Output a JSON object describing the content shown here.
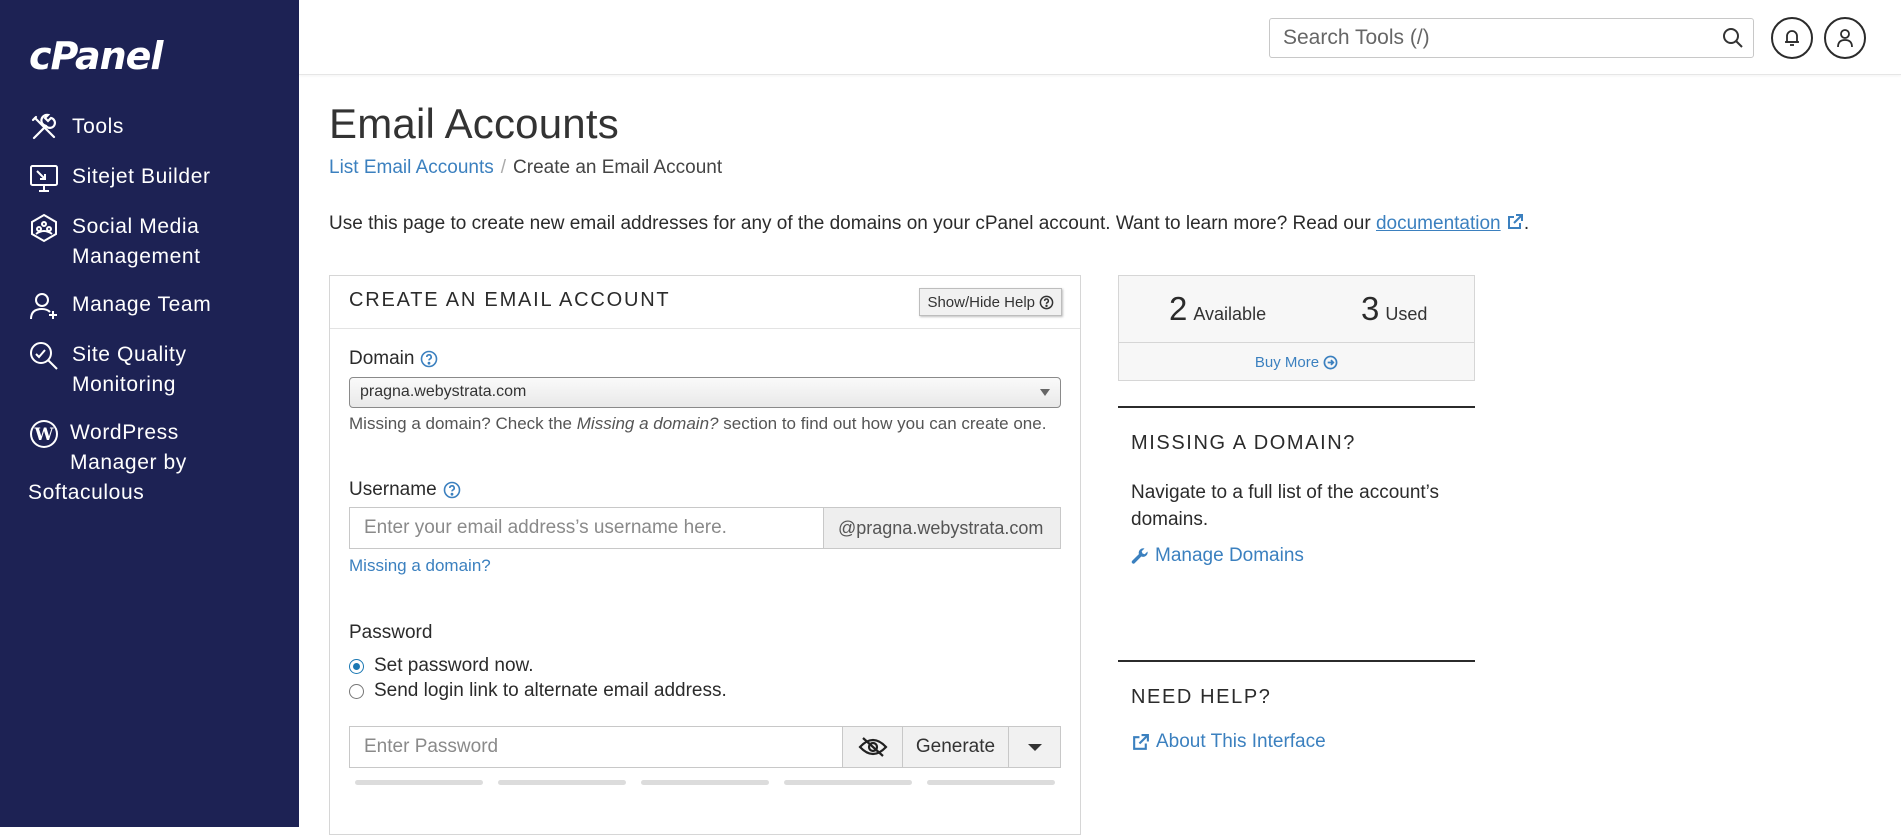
{
  "app": {
    "logo": "cPanel"
  },
  "sidebar": {
    "items": [
      {
        "label": "Tools",
        "icon": "tools-icon"
      },
      {
        "label": "Sitejet Builder",
        "icon": "sitejet-monitor-icon"
      },
      {
        "label": "Social Media",
        "label2": "Management",
        "icon": "social-media-icon"
      },
      {
        "label": "Manage Team",
        "icon": "manage-team-icon"
      },
      {
        "label": "Site Quality",
        "label2": "Monitoring",
        "icon": "site-quality-icon"
      },
      {
        "label": "WordPress",
        "label2": "Manager by",
        "label3": "Softaculous",
        "icon": "wordpress-icon"
      }
    ]
  },
  "topbar": {
    "search_placeholder": "Search Tools (/)",
    "icons": [
      "search-icon",
      "bell-icon",
      "user-icon"
    ]
  },
  "page": {
    "title": "Email Accounts",
    "breadcrumb": {
      "parent": "List Email Accounts",
      "separator": "/",
      "current": "Create an Email Account"
    },
    "intro_text": "Use this page to create new email addresses for any of the domains on your cPanel account. Want to learn more? Read our",
    "intro_link": "documentation",
    "intro_end": "."
  },
  "form": {
    "title": "CREATE AN EMAIL ACCOUNT",
    "help_button": "Show/Hide Help",
    "domain": {
      "label": "Domain",
      "value": "pragna.webystrata.com",
      "hint_pre": "Missing a domain? Check the",
      "hint_em": "Missing a domain?",
      "hint_post": "section to find out how you can create one."
    },
    "username": {
      "label": "Username",
      "placeholder": "Enter your email address’s username here.",
      "suffix": "@pragna.webystrata.com",
      "missing_link": "Missing a domain?"
    },
    "password": {
      "label": "Password",
      "option_set_now": "Set password now.",
      "option_send_link": "Send login link to alternate email address.",
      "placeholder": "Enter Password",
      "generate_label": "Generate"
    }
  },
  "stats": {
    "available_count": "2",
    "available_label": "Available",
    "used_count": "3",
    "used_label": "Used",
    "buy_more": "Buy More"
  },
  "missing_domain": {
    "title": "MISSING A DOMAIN?",
    "text": "Navigate to a full list of the account’s domains.",
    "link": "Manage Domains"
  },
  "need_help": {
    "title": "NEED HELP?",
    "link": "About This Interface"
  },
  "colors": {
    "sidebar_bg": "#1d2254",
    "link": "#3b80bf",
    "radio_accent": "#1b78b3"
  }
}
